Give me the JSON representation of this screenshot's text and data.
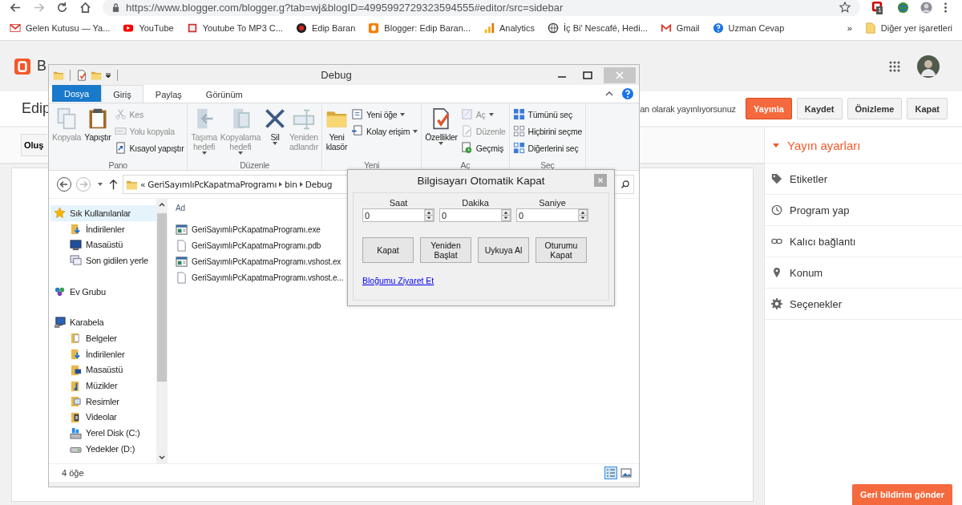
{
  "browser": {
    "url": "https://www.blogger.com/blogger.g?tab=wj&blogID=4995992729323594555#editor/src=sidebar",
    "extension_badge": "1"
  },
  "bookmarks": [
    {
      "label": "Gelen Kutusu — Ya..."
    },
    {
      "label": "YouTube"
    },
    {
      "label": "Youtube To MP3 C..."
    },
    {
      "label": "Edip Baran"
    },
    {
      "label": "Blogger: Edip Baran..."
    },
    {
      "label": "Analytics"
    },
    {
      "label": "İç Bi' Nescafé, Hedi..."
    },
    {
      "label": "Gmail"
    },
    {
      "label": "Uzman Cevap"
    }
  ],
  "bookmarks_more": "»",
  "other_bookmarks": "Diğer yer işaretleri",
  "blogger": {
    "logo_text": "B",
    "post_title": "Edip",
    "publish_note": "an olarak yayınlıyorsunuz",
    "buttons": [
      {
        "label": "Yayınla",
        "kind": "primary"
      },
      {
        "label": "Kaydet",
        "kind": "normal"
      },
      {
        "label": "Önizleme",
        "kind": "normal"
      },
      {
        "label": "Kapat",
        "kind": "normal"
      }
    ],
    "compose_button": "Oluş",
    "sidebar": {
      "title": "Yayın ayarları",
      "items": [
        {
          "label": "Etiketler"
        },
        {
          "label": "Program yap"
        },
        {
          "label": "Kalıcı bağlantı"
        },
        {
          "label": "Konum"
        },
        {
          "label": "Seçenekler"
        }
      ]
    },
    "feedback": "Geri bildirim gönder"
  },
  "explorer": {
    "title": "Debug",
    "tabs": [
      {
        "label": "Dosya",
        "kind": "file",
        "selected": false
      },
      {
        "label": "Giriş",
        "kind": "tab",
        "selected": true
      },
      {
        "label": "Paylaş",
        "kind": "tab",
        "selected": false
      },
      {
        "label": "Görünüm",
        "kind": "tab",
        "selected": false
      }
    ],
    "ribbon": [
      {
        "label": "Pano",
        "items": [
          {
            "label": "Kopyala",
            "kind": "large",
            "disabled": true
          },
          {
            "label": "Yapıştır",
            "kind": "large",
            "disabled": false
          },
          {
            "label": "Kes",
            "kind": "small",
            "disabled": true
          },
          {
            "label": "Yolu kopyala",
            "kind": "small",
            "disabled": true
          },
          {
            "label": "Kısayol yapıştır",
            "kind": "small",
            "disabled": false
          }
        ]
      },
      {
        "label": "Düzenle",
        "items": [
          {
            "label": "Taşıma hedefi",
            "kind": "large",
            "disabled": true,
            "dropdown": true
          },
          {
            "label": "Kopyalama hedefi",
            "kind": "large",
            "disabled": true,
            "dropdown": true
          },
          {
            "label": "Sil",
            "kind": "large",
            "disabled": false,
            "dropdown": true
          },
          {
            "label": "Yeniden adlandır",
            "kind": "large",
            "disabled": true
          }
        ]
      },
      {
        "label": "Yeni",
        "items": [
          {
            "label": "Yeni klasör",
            "kind": "large",
            "disabled": false
          },
          {
            "label": "Yeni öğe",
            "kind": "small",
            "disabled": false,
            "dropdown": true
          },
          {
            "label": "Kolay erişim",
            "kind": "small",
            "disabled": false,
            "dropdown": true
          }
        ]
      },
      {
        "label": "Aç",
        "items": [
          {
            "label": "Özellikler",
            "kind": "large",
            "disabled": false,
            "dropdown": true
          },
          {
            "label": "Aç",
            "kind": "small",
            "disabled": true,
            "dropdown": true
          },
          {
            "label": "Düzenle",
            "kind": "small",
            "disabled": true
          },
          {
            "label": "Geçmiş",
            "kind": "small",
            "disabled": false
          }
        ]
      },
      {
        "label": "Seç",
        "items": [
          {
            "label": "Tümünü seç",
            "kind": "small",
            "disabled": false
          },
          {
            "label": "Hiçbirini seçme",
            "kind": "small",
            "disabled": false
          },
          {
            "label": "Diğerlerini seç",
            "kind": "small",
            "disabled": false
          }
        ]
      }
    ],
    "path_prefix": "«",
    "path": [
      "GeriSayımlıPcKapatmaProgramı",
      "bin",
      "Debug"
    ],
    "nav": [
      {
        "label": "Sık Kullanılanlar",
        "selected": true,
        "children": [
          {
            "label": "İndirilenler",
            "selected": false
          },
          {
            "label": "Masaüstü",
            "selected": false
          },
          {
            "label": "Son gidilen yerle",
            "selected": false
          }
        ]
      },
      {
        "label": "Ev Grubu",
        "selected": false
      },
      {
        "label": "Karabela",
        "selected": false,
        "children": [
          {
            "label": "Belgeler",
            "selected": false
          },
          {
            "label": "İndirilenler",
            "selected": false
          },
          {
            "label": "Masaüstü",
            "selected": false
          },
          {
            "label": "Müzikler",
            "selected": false
          },
          {
            "label": "Resimler",
            "selected": false
          },
          {
            "label": "Videolar",
            "selected": false
          },
          {
            "label": "Yerel Disk (C:)",
            "selected": false
          },
          {
            "label": "Yedekler (D:)",
            "selected": false
          }
        ]
      }
    ],
    "column": "Ad",
    "files": [
      {
        "name": "GeriSayımlıPcKapatmaProgramı.exe",
        "kind": "program"
      },
      {
        "name": "GeriSayımlıPcKapatmaProgramı.pdb",
        "kind": "document"
      },
      {
        "name": "GeriSayımlıPcKapatmaProgramı.vshost.ex",
        "kind": "program"
      },
      {
        "name": "GeriSayımlıPcKapatmaProgramı.vshost.e...",
        "kind": "document"
      }
    ],
    "status": "4 öğe"
  },
  "dialog": {
    "title": "Bilgisayarı Otomatik Kapat",
    "fields": [
      {
        "label": "Saat",
        "value": "0"
      },
      {
        "label": "Dakika",
        "value": "0"
      },
      {
        "label": "Saniye",
        "value": "0"
      }
    ],
    "buttons": [
      "Kapat",
      "Yeniden Başlat",
      "Uykuya Al",
      "Oturumu Kapat"
    ],
    "link": "Bloğumu Ziyaret Et"
  }
}
